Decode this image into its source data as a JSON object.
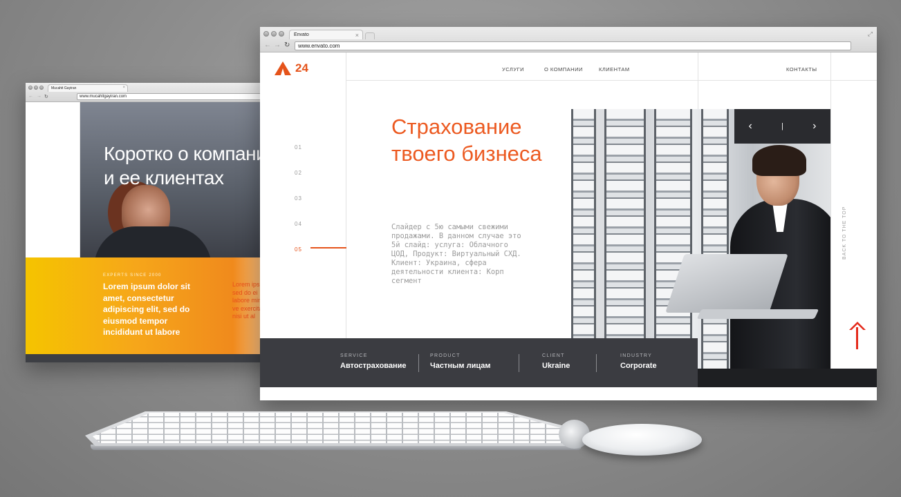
{
  "left_browser": {
    "tab_title": "Mucahit Gayiran",
    "url": "www.mucahitgayiran.com",
    "hero_title": "Коротко о компании и ее клиентах",
    "experts_since": "EXPERTS SINCE 2000",
    "lorem_bold": "Lorem ipsum dolor sit amet, consectetur adipiscing elit, sed do eiusmod tempor incididunt ut labore",
    "lorem_small": "Lorem ipsum sed do ei labore minim ve exercitat nisi ut al"
  },
  "right_browser": {
    "tab_title": "Envato",
    "url": "www.envato.com",
    "logo_number": "24",
    "nav": [
      "УСЛУГИ",
      "О КОМПАНИИ",
      "КЛИЕНТАМ"
    ],
    "contacts": "КОНТАКТЫ",
    "slides": [
      "01",
      "02",
      "03",
      "04",
      "05"
    ],
    "active_slide": "05",
    "hero_title": "Страхование твоего бизнеса",
    "hero_description": "Слайдер с 5ю самыми свежими продажами. В данном случае это 5й слайд: услуга: Облачного ЦОД, Продукт: Виртуальный СХД. Клиент: Украина, сфера деятельности клиента: Корп сегмент",
    "slider_prev": "‹",
    "slider_sep": "|",
    "slider_next": "›",
    "back_to_top": "BACK TO THE TOP",
    "info": [
      {
        "label": "SERVICE",
        "value": "Автострахование"
      },
      {
        "label": "PRODUCT",
        "value": "Частным лицам"
      },
      {
        "label": "CLIENT",
        "value": "Ukraine"
      },
      {
        "label": "INDUSTRY",
        "value": "Corporate"
      }
    ]
  },
  "colors": {
    "accent_orange": "#ec5a21",
    "arrow_red": "#e42b1c",
    "dark_bar": "#3b3c41"
  }
}
